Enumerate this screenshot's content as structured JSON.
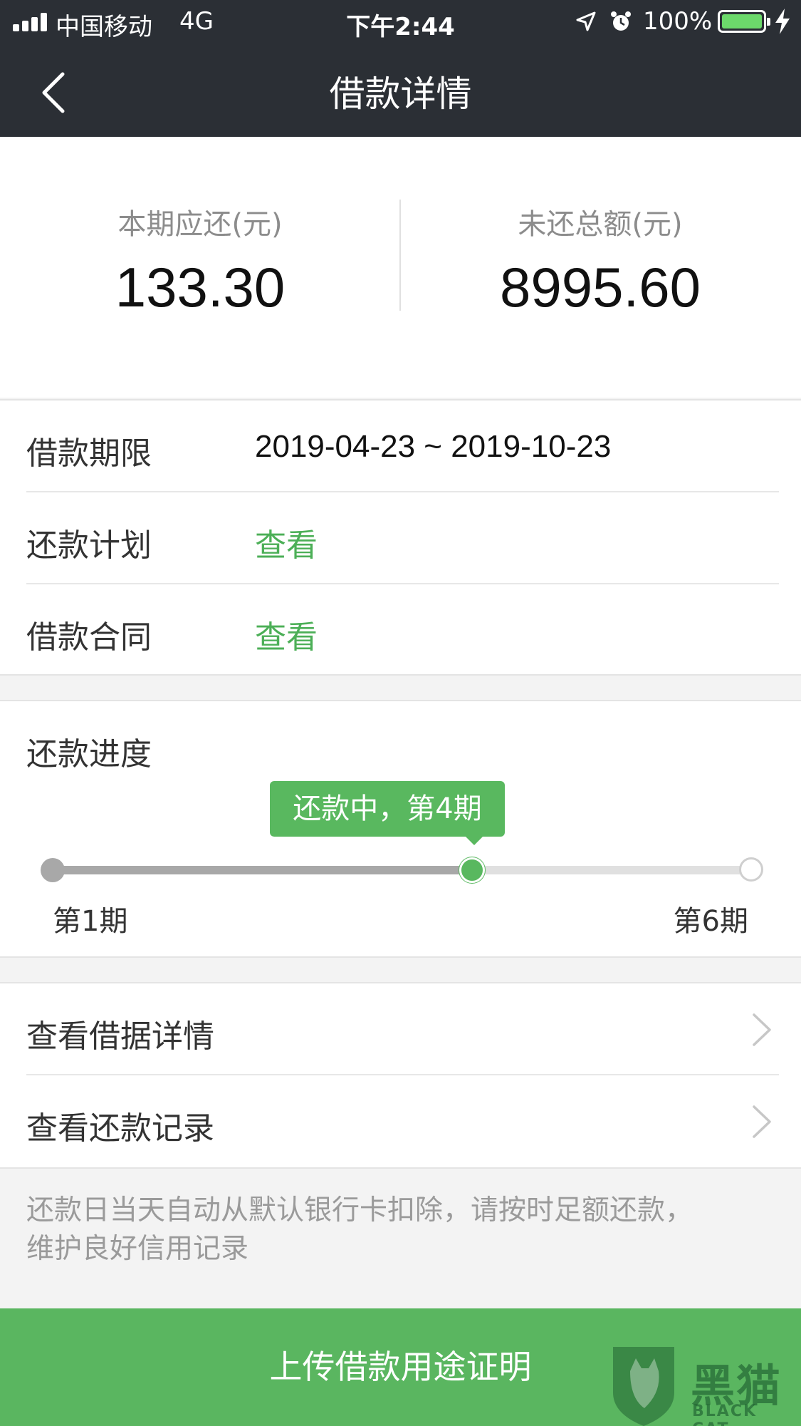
{
  "status_bar": {
    "carrier": "中国移动",
    "network": "4G",
    "time": "下午2:44",
    "battery_percent": "100%",
    "battery_level": 1.0,
    "icons": [
      "signal-icon",
      "location-icon",
      "alarm-icon",
      "battery-icon",
      "charging-icon"
    ]
  },
  "nav": {
    "title": "借款详情",
    "back_icon": "chevron-left-icon"
  },
  "summary": {
    "current_due_label": "本期应还(元)",
    "current_due_value": "133.30",
    "outstanding_label": "未还总额(元)",
    "outstanding_value": "8995.60"
  },
  "info": {
    "term_label": "借款期限",
    "term_value": "2019-04-23 ~ 2019-10-23",
    "plan_label": "还款计划",
    "plan_link": "查看",
    "contract_label": "借款合同",
    "contract_link": "查看"
  },
  "progress": {
    "title": "还款进度",
    "tooltip": "还款中，第4期",
    "start_label": "第1期",
    "end_label": "第6期",
    "fraction": 0.6
  },
  "links": {
    "iou_details": "查看借据详情",
    "repayment_records": "查看还款记录"
  },
  "notice": {
    "line1": "还款日当天自动从默认银行卡扣除，请按时足额还款，",
    "line2": "维护良好信用记录"
  },
  "bottom": {
    "upload_label": "上传借款用途证明"
  },
  "watermark": {
    "text": "黑猫",
    "sub": "BLACK CAT"
  },
  "colors": {
    "accent_green": "#59b85f",
    "link_green": "#4caf57",
    "topbar": "#2b2f35"
  }
}
